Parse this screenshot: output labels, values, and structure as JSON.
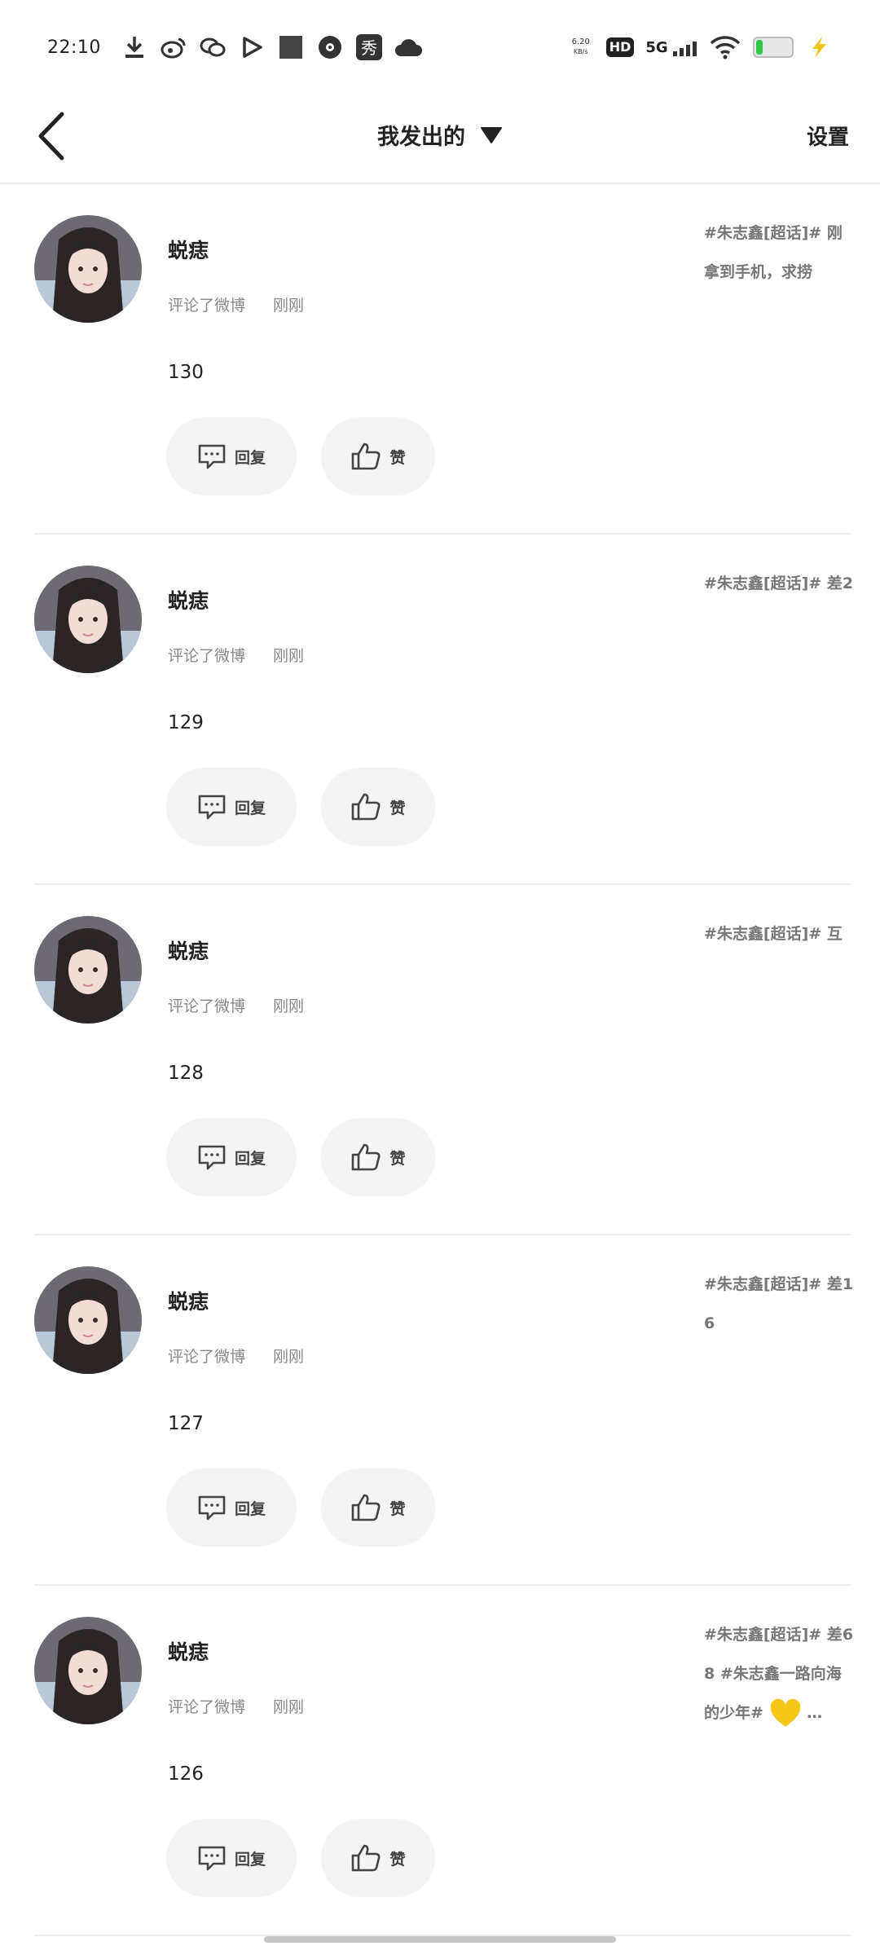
{
  "status_bar": {
    "time": "22:10",
    "net_speed_value": "6.20",
    "net_speed_unit": "KB/s",
    "hd_label": "HD",
    "network_label": "5G",
    "left_icons": [
      "download-icon",
      "weibo-icon",
      "wechat-icon",
      "video-icon",
      "square-icon",
      "music-icon",
      "xiu-icon",
      "cloud-icon"
    ],
    "xiu_label": "秀",
    "battery_level": 0.15,
    "battery_color": "#30c84a",
    "charging_color": "#f0c419"
  },
  "header": {
    "title": "我发出的",
    "settings_label": "设置"
  },
  "feed": {
    "items": [
      {
        "name": "蜕痣",
        "action": "评论了微博",
        "time": "刚刚",
        "count": "130",
        "reply_label": "回复",
        "like_label": "赞",
        "source_text": "#朱志鑫[超话]# 刚拿到手机，求捞"
      },
      {
        "name": "蜕痣",
        "action": "评论了微博",
        "time": "刚刚",
        "count": "129",
        "reply_label": "回复",
        "like_label": "赞",
        "source_text": "#朱志鑫[超话]# 差2"
      },
      {
        "name": "蜕痣",
        "action": "评论了微博",
        "time": "刚刚",
        "count": "128",
        "reply_label": "回复",
        "like_label": "赞",
        "source_text": "#朱志鑫[超话]# 互"
      },
      {
        "name": "蜕痣",
        "action": "评论了微博",
        "time": "刚刚",
        "count": "127",
        "reply_label": "回复",
        "like_label": "赞",
        "source_text": "#朱志鑫[超话]# 差16"
      },
      {
        "name": "蜕痣",
        "action": "评论了微博",
        "time": "刚刚",
        "count": "126",
        "reply_label": "回复",
        "like_label": "赞",
        "source_text": "#朱志鑫[超话]# 差68 #朱志鑫一路向海的少年#",
        "source_suffix": "…"
      }
    ]
  }
}
